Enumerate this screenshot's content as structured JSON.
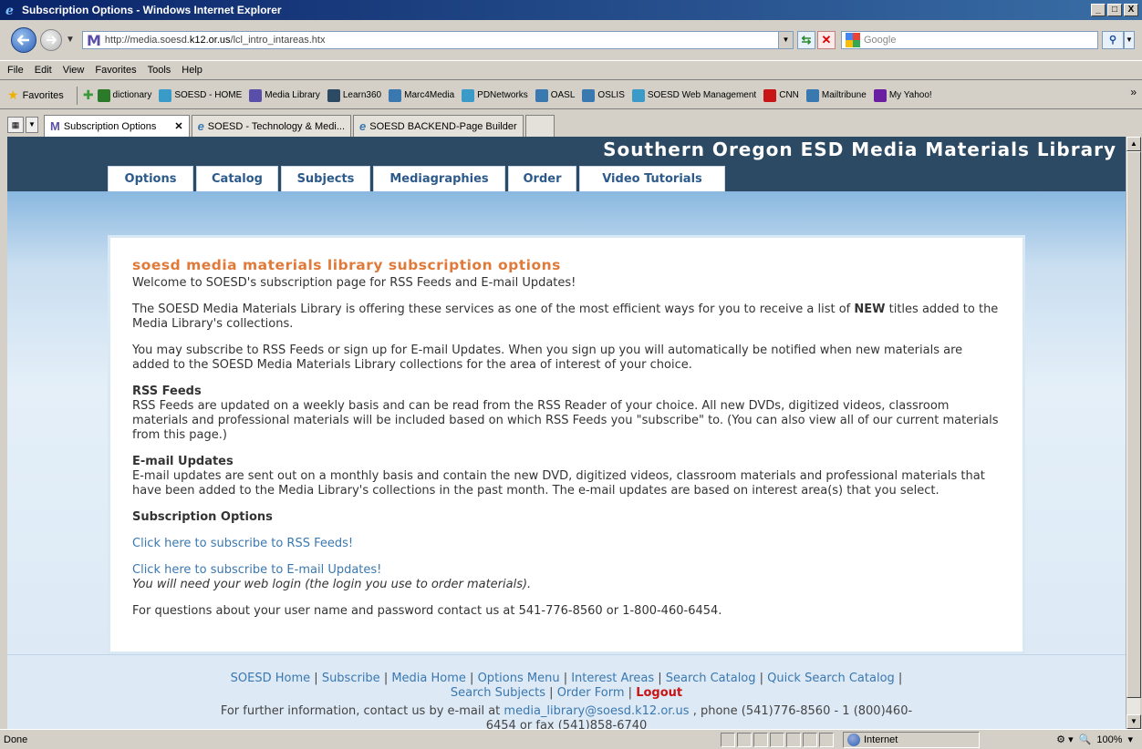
{
  "window": {
    "title": "Subscription Options - Windows Internet Explorer",
    "minimize": "_",
    "maximize": "□",
    "close": "X"
  },
  "address": {
    "url_prefix": "http://media.soesd.",
    "url_domain": "k12.or.us",
    "url_path": "/lcl_intro_intareas.htx",
    "search_placeholder": "Google"
  },
  "menu": [
    "File",
    "Edit",
    "View",
    "Favorites",
    "Tools",
    "Help"
  ],
  "favorites_bar": {
    "label": "Favorites",
    "items": [
      {
        "label": "dictionary",
        "icon": "dictionary-icon",
        "color": "#2a7a2a"
      },
      {
        "label": "SOESD - HOME",
        "icon": "soesd-icon",
        "color": "#3a9ac8"
      },
      {
        "label": "Media Library",
        "icon": "media-library-icon",
        "color": "#5a4fa8"
      },
      {
        "label": "Learn360",
        "icon": "learn360-icon",
        "color": "#2c4a63"
      },
      {
        "label": "Marc4Media",
        "icon": "ie-page-icon",
        "color": "#3a78b0"
      },
      {
        "label": "PDNetworks",
        "icon": "soesd-icon",
        "color": "#3a9ac8"
      },
      {
        "label": "OASL",
        "icon": "ie-page-icon",
        "color": "#3a78b0"
      },
      {
        "label": "OSLIS",
        "icon": "ie-page-icon",
        "color": "#3a78b0"
      },
      {
        "label": "SOESD Web Management",
        "icon": "soesd-icon",
        "color": "#3a9ac8"
      },
      {
        "label": "CNN",
        "icon": "cnn-icon",
        "color": "#c81414"
      },
      {
        "label": "Mailtribune",
        "icon": "ie-page-icon",
        "color": "#3a78b0"
      },
      {
        "label": "My Yahoo!",
        "icon": "yahoo-icon",
        "color": "#6a1fa0"
      }
    ]
  },
  "tabs": [
    {
      "label": "Subscription Options",
      "active": true
    },
    {
      "label": "SOESD - Technology & Medi...",
      "active": false
    },
    {
      "label": "SOESD BACKEND-Page Builder",
      "active": false
    }
  ],
  "site": {
    "title": "Southern Oregon ESD Media Materials Library",
    "nav": [
      "Options",
      "Catalog",
      "Subjects",
      "Mediagraphies",
      "Order",
      "Video Tutorials"
    ]
  },
  "content": {
    "heading": "soesd media materials library subscription options",
    "welcome": "Welcome to SOESD's subscription page for RSS Feeds and E-mail Updates!",
    "intro_a": "The SOESD Media Materials Library is offering these services as one of the most efficient ways for you to receive a list of ",
    "intro_new": "NEW",
    "intro_b": " titles added to the Media Library's collections.",
    "subscribe_info": "You may subscribe to RSS Feeds or sign up for E-mail Updates. When you sign up you will automatically be notified when new materials are added to the SOESD Media Materials Library collections for the area of interest of your choice.",
    "rss_head": "RSS Feeds",
    "rss_body": "RSS Feeds are updated on a weekly basis and can be read from the RSS Reader of your choice. All new DVDs, digitized videos, classroom materials and professional materials will be included based on which RSS Feeds you \"subscribe\" to. (You can also view all of our current materials from this page.)",
    "email_head": "E-mail Updates",
    "email_body": "E-mail updates are sent out on a monthly basis and contain the new DVD, digitized videos, classroom materials and professional materials that have been added to the Media Library's collections in the past month. The e-mail updates are based on interest area(s) that you select.",
    "options_head": "Subscription Options",
    "rss_link": "Click here to subscribe to RSS Feeds!",
    "email_link": "Click here to subscribe to E-mail Updates!",
    "login_note": "You will need your web login (the login you use to order materials).",
    "questions": "For questions about your user name and password contact us at 541-776-8560 or 1-800-460-6454."
  },
  "footer": {
    "links": [
      "SOESD Home",
      "Subscribe",
      "Media Home",
      "Options Menu",
      "Interest Areas",
      "Search Catalog",
      "Quick Search Catalog",
      "Search Subjects",
      "Order Form"
    ],
    "logout": "Logout",
    "contact_a": "For further information, contact us by e-mail at ",
    "contact_email": "media_library@soesd.k12.or.us",
    "contact_b": " , phone (541)776-8560 - 1 (800)460-",
    "contact_c": "6454 or fax (541)858-6740"
  },
  "status": {
    "text": "Done",
    "zone": "Internet",
    "zoom": "100%"
  },
  "colors": {
    "header_bg": "#2c4a63",
    "heading_orange": "#e07a3a",
    "link_blue": "#3a78b0",
    "logout_red": "#c81414"
  }
}
